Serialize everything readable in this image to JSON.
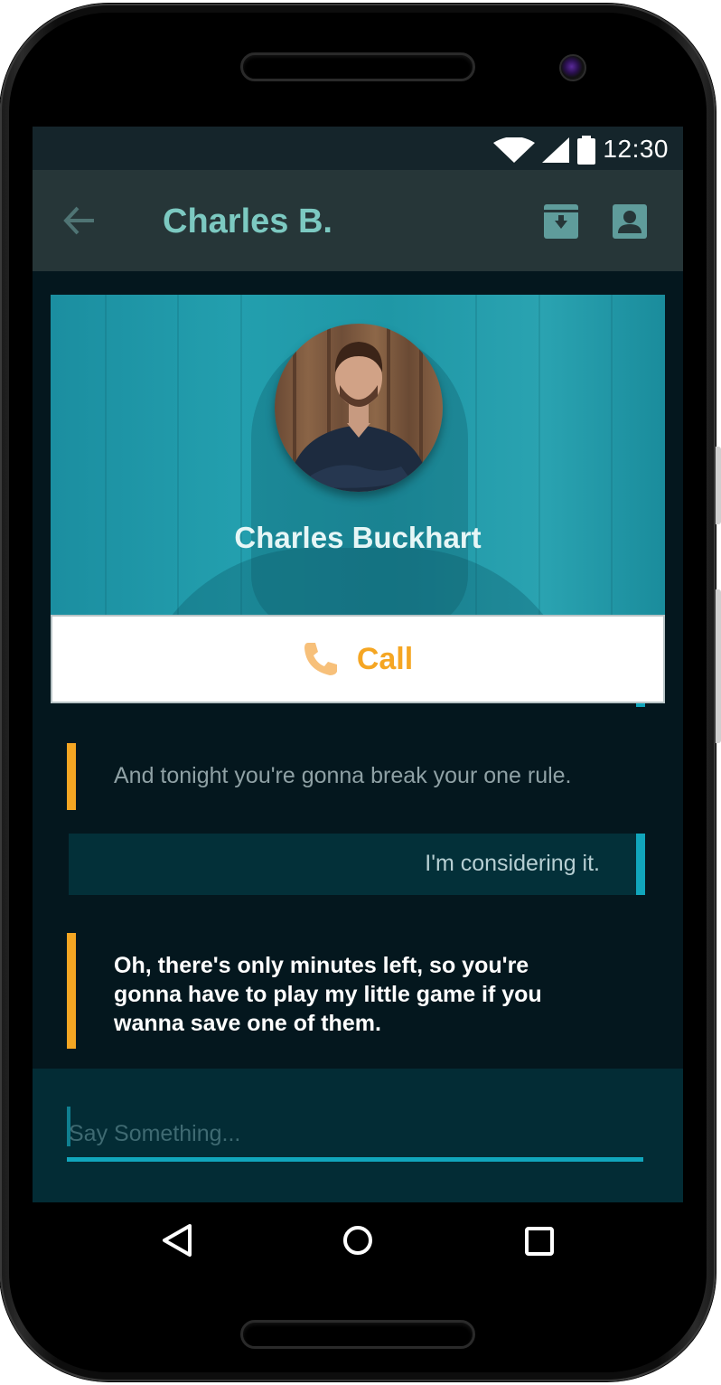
{
  "status_bar": {
    "time": "12:30"
  },
  "app_bar": {
    "title": "Charles B."
  },
  "profile": {
    "name": "Charles Buckhart"
  },
  "call_button": {
    "label": "Call"
  },
  "messages": [
    {
      "direction": "incoming",
      "text": "And tonight you're gonna break your one rule."
    },
    {
      "direction": "outgoing",
      "text": "I'm considering it."
    },
    {
      "direction": "incoming",
      "text": "Oh, there's only minutes left, so you're gonna have to play my little game if you wanna save one of them."
    }
  ],
  "composer": {
    "placeholder": "Say Something..."
  },
  "colors": {
    "incoming_accent": "#f5a623",
    "outgoing_accent": "#11a6bc",
    "app_bar": "#263638",
    "title_text": "#7cc9c1"
  },
  "icons": {
    "back": "arrow-left-icon",
    "archive": "archive-icon",
    "contact": "contact-icon",
    "call": "phone-icon",
    "wifi": "wifi-icon",
    "signal": "signal-icon",
    "battery": "battery-icon",
    "nav_back": "triangle-back-icon",
    "nav_home": "circle-home-icon",
    "nav_recent": "square-recent-icon"
  }
}
